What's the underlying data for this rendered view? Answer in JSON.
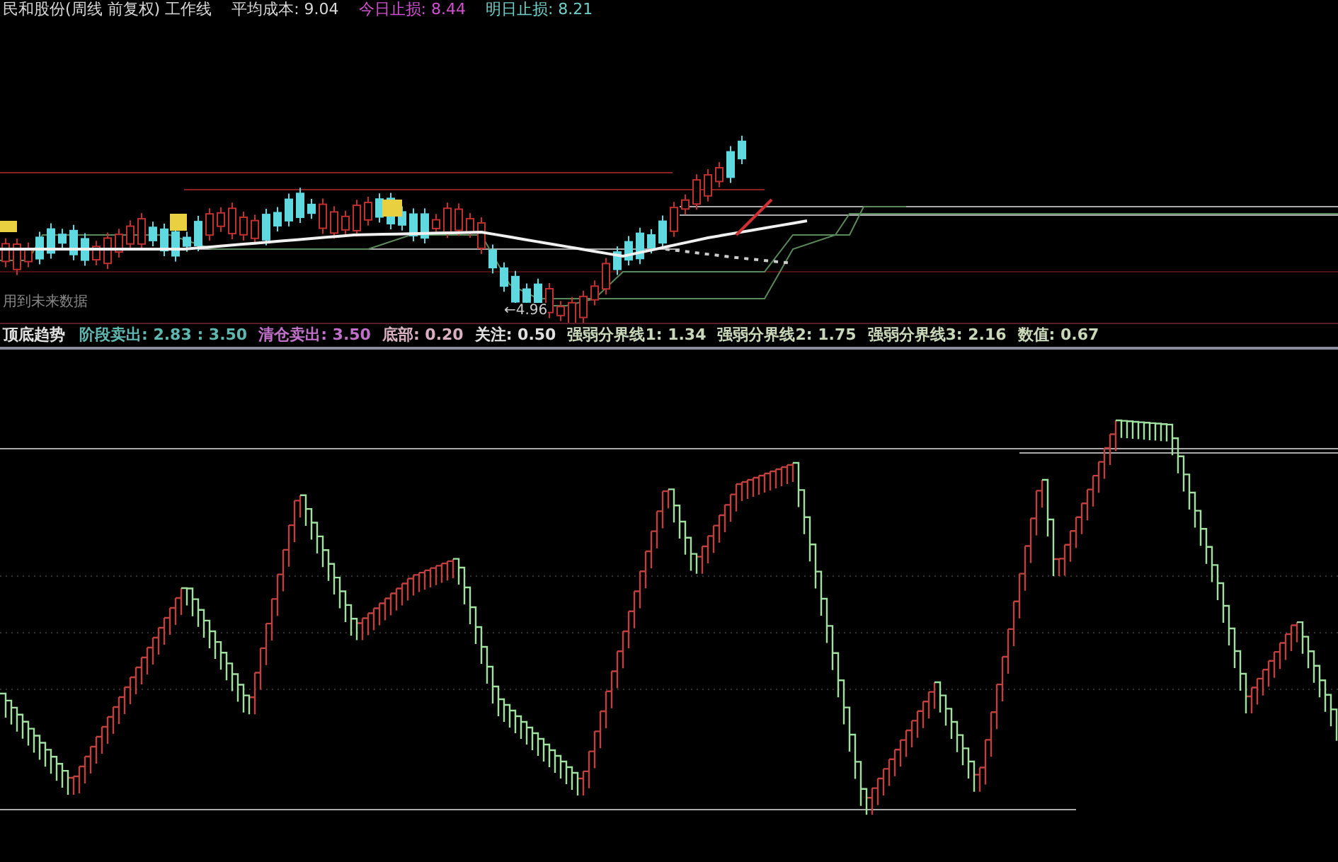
{
  "header": {
    "title": "民和股份(周线 前复权) 工作线",
    "cost": "平均成本: 9.04",
    "stop_today": "今日止损: 8.44",
    "stop_tomorrow": "明日止损: 8.21"
  },
  "price_panel": {
    "note": "用到未来数据",
    "low_marker": "←4.96"
  },
  "indicator_bar": {
    "name": "顶底趋势",
    "items": [
      {
        "label": "阶段卖出: 2.83 : 3.50",
        "kind": "sell"
      },
      {
        "label": "清仓卖出: 3.50",
        "kind": "clear"
      },
      {
        "label": "底部: 0.20",
        "kind": "bottom"
      },
      {
        "label": "关注: 0.50",
        "kind": "watch"
      },
      {
        "label": "强弱分界线1: 1.34",
        "kind": "threshold"
      },
      {
        "label": "强弱分界线2: 1.75",
        "kind": "threshold"
      },
      {
        "label": "强弱分界线3: 2.16",
        "kind": "threshold"
      },
      {
        "label": "数值: 0.67",
        "kind": "threshold"
      }
    ]
  }
}
